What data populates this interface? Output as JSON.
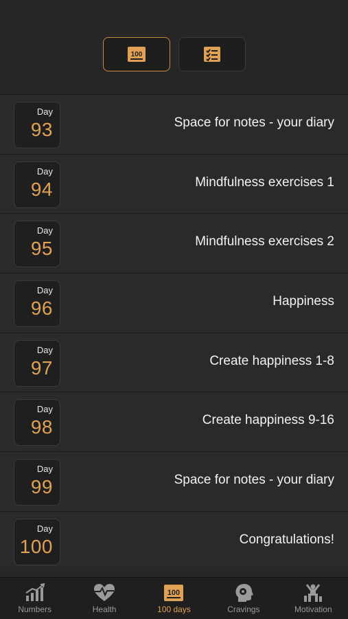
{
  "segmented_control": {
    "left_icon": "100-emoji-icon",
    "right_icon": "checklist-icon",
    "active": "left"
  },
  "colors": {
    "accent": "#e0a155",
    "background": "#262626",
    "row_background": "#2a2a2a",
    "tabbar_background": "#1f1f1f"
  },
  "list": {
    "day_label": "Day",
    "items": [
      {
        "day": "93",
        "title": "Space for notes - your diary"
      },
      {
        "day": "94",
        "title": "Mindfulness exercises 1"
      },
      {
        "day": "95",
        "title": "Mindfulness exercises 2"
      },
      {
        "day": "96",
        "title": "Happiness"
      },
      {
        "day": "97",
        "title": "Create happiness 1-8"
      },
      {
        "day": "98",
        "title": "Create happiness 9-16"
      },
      {
        "day": "99",
        "title": "Space for notes - your diary"
      },
      {
        "day": "100",
        "title": "Congratulations!"
      }
    ]
  },
  "tabbar": {
    "tabs": [
      {
        "label": "Numbers",
        "icon": "bar-chart-icon"
      },
      {
        "label": "Health",
        "icon": "heart-pulse-icon"
      },
      {
        "label": "100 days",
        "icon": "100-emoji-icon",
        "active": true
      },
      {
        "label": "Cravings",
        "icon": "head-mind-icon"
      },
      {
        "label": "Motivation",
        "icon": "person-cheer-icon"
      }
    ]
  }
}
